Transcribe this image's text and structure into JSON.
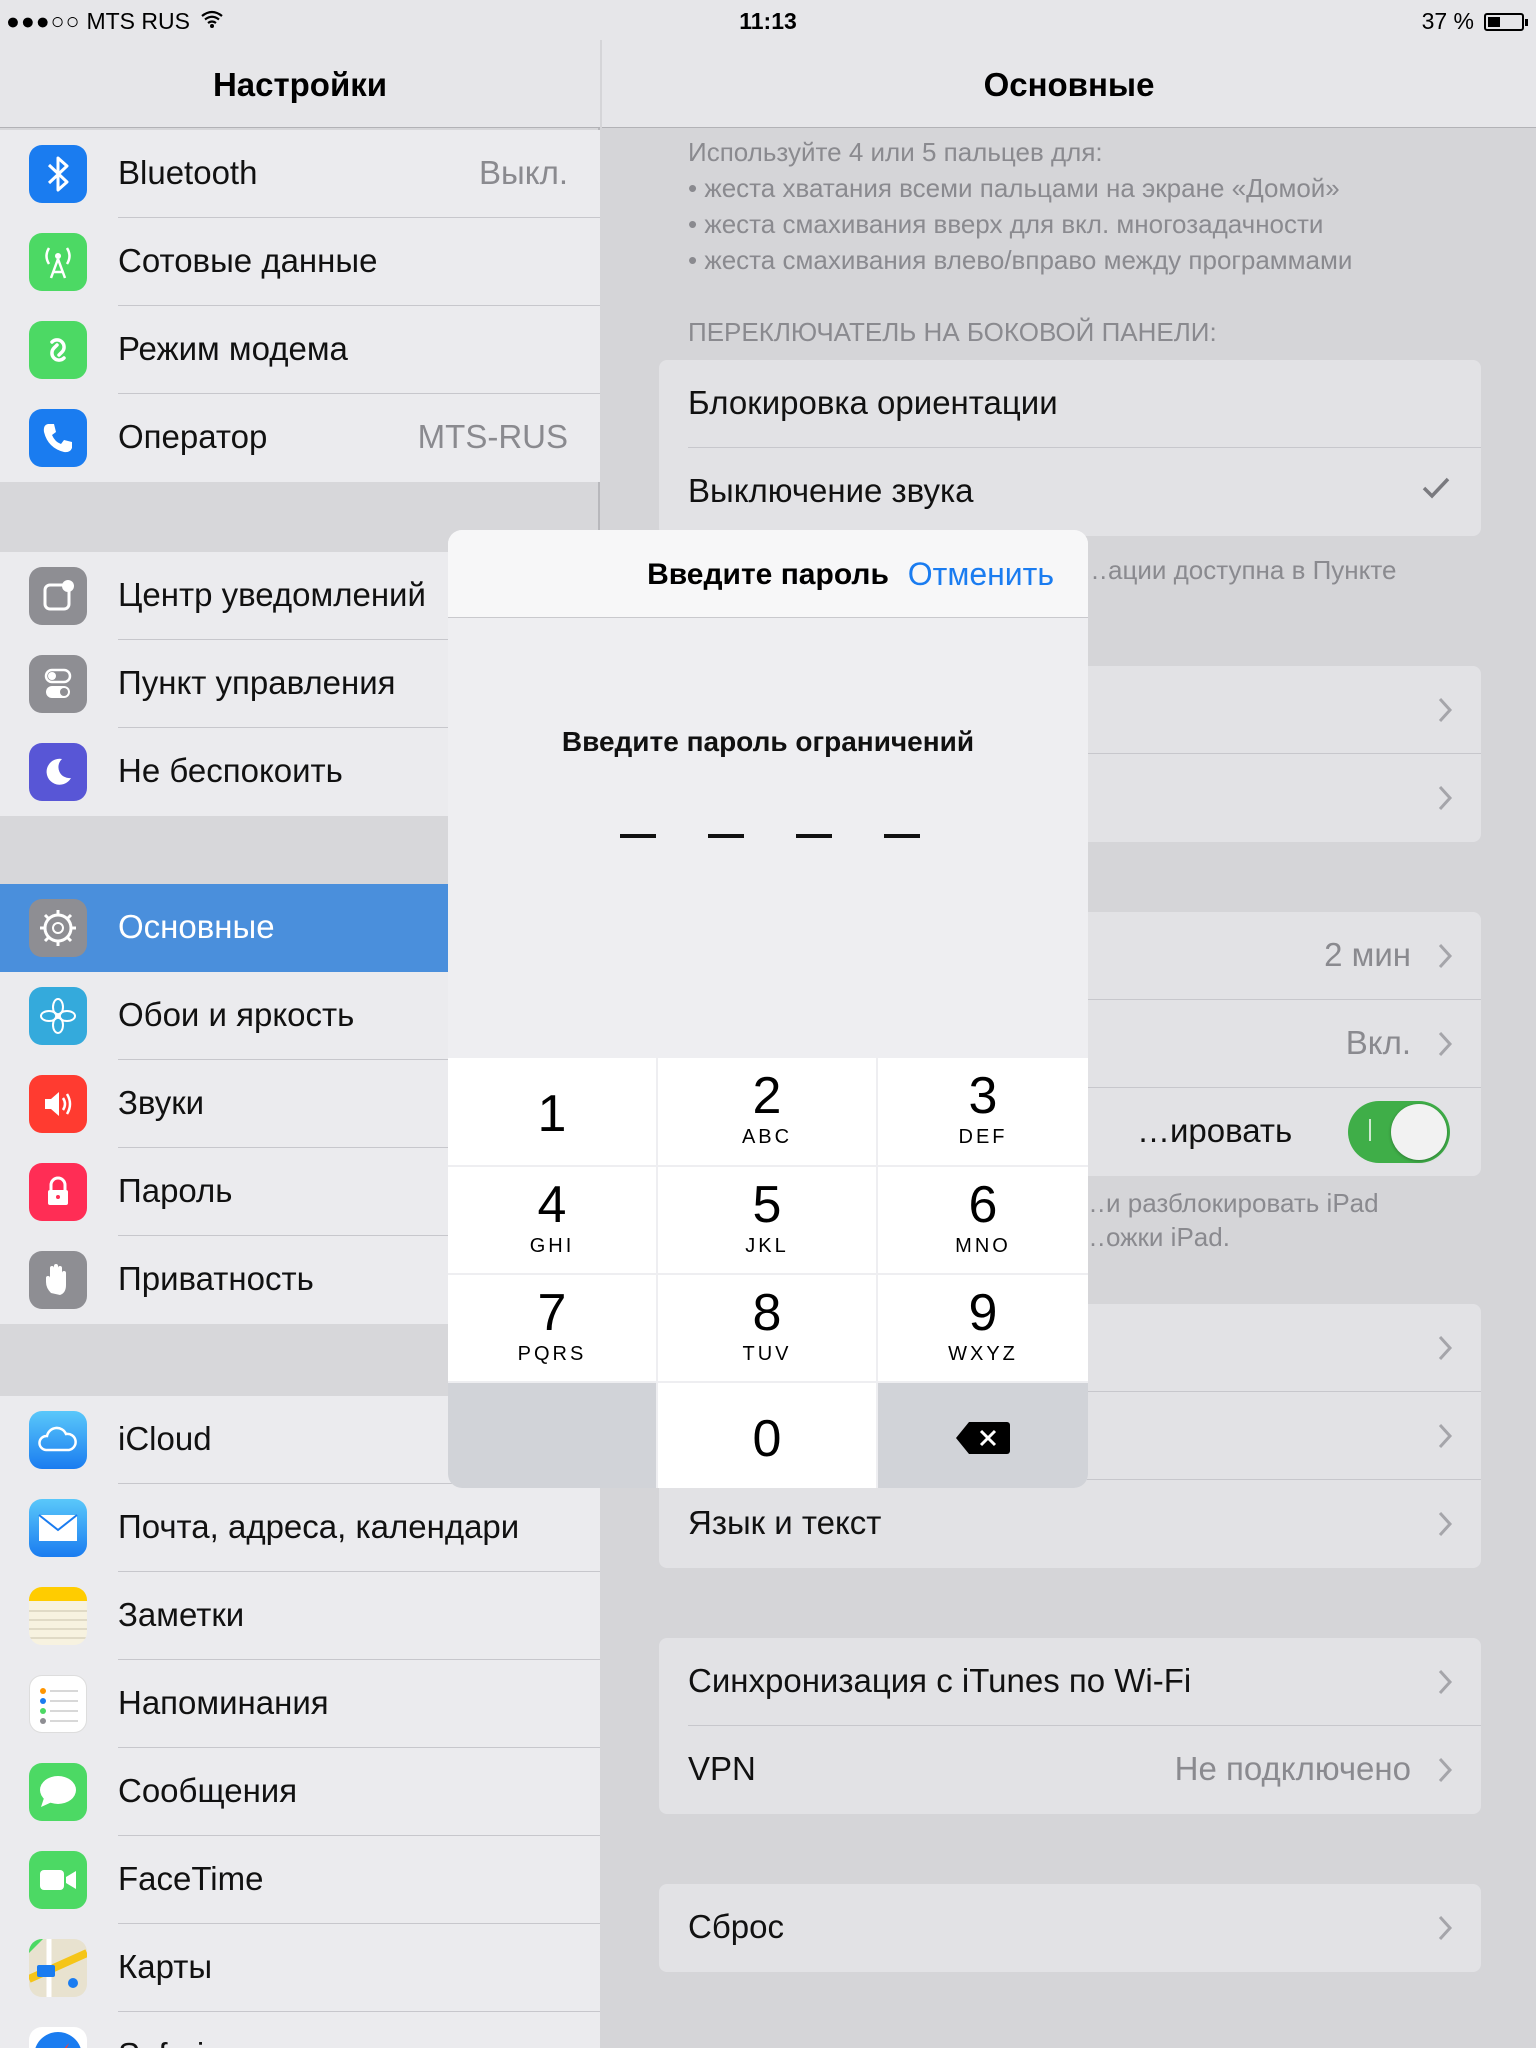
{
  "status_bar": {
    "carrier": "MTS RUS",
    "time": "11:13",
    "battery": "37 %",
    "battery_level": 0.37
  },
  "left_panel": {
    "title": "Настройки",
    "groups": [
      {
        "items": [
          {
            "label": "Bluetooth",
            "value": "Выкл.",
            "icon": "bluetooth-icon",
            "color": "#1a7cf0"
          },
          {
            "label": "Сотовые данные",
            "icon": "cellular-icon",
            "color": "#4cd964"
          },
          {
            "label": "Режим модема",
            "icon": "hotspot-icon",
            "color": "#4cd964"
          },
          {
            "label": "Оператор",
            "value": "MTS-RUS",
            "icon": "phone-icon",
            "color": "#1a7cf0"
          }
        ]
      },
      {
        "items": [
          {
            "label": "Центр уведомлений",
            "icon": "notifications-icon",
            "color": "#8e8e93"
          },
          {
            "label": "Пункт управления",
            "icon": "control-center-icon",
            "color": "#8e8e93"
          },
          {
            "label": "Не беспокоить",
            "icon": "moon-icon",
            "color": "#5856d6"
          }
        ]
      },
      {
        "items": [
          {
            "label": "Основные",
            "icon": "gear-icon",
            "color": "#8e8e93",
            "selected": true
          },
          {
            "label": "Обои и яркость",
            "icon": "wallpaper-icon",
            "color": "#34aadc"
          },
          {
            "label": "Звуки",
            "icon": "sound-icon",
            "color": "#ff3b30"
          },
          {
            "label": "Пароль",
            "icon": "lock-icon",
            "color": "#ff2d55"
          },
          {
            "label": "Приватность",
            "icon": "hand-icon",
            "color": "#8e8e93"
          }
        ]
      },
      {
        "items": [
          {
            "label": "iCloud",
            "icon": "cloud-icon",
            "color": "#5ac8fa"
          },
          {
            "label": "Почта, адреса, календари",
            "icon": "mail-icon",
            "color": "#1a7cf0"
          },
          {
            "label": "Заметки",
            "icon": "notes-icon",
            "color": "#ffcc00"
          },
          {
            "label": "Напоминания",
            "icon": "reminders-icon",
            "color": "#ffffff"
          },
          {
            "label": "Сообщения",
            "icon": "messages-icon",
            "color": "#4cd964"
          },
          {
            "label": "FaceTime",
            "icon": "facetime-icon",
            "color": "#4cd964"
          },
          {
            "label": "Карты",
            "icon": "maps-icon",
            "color": "#e8e2cf"
          },
          {
            "label": "Safari",
            "icon": "safari-icon",
            "color": "#1a7cf0"
          }
        ]
      }
    ]
  },
  "right_panel": {
    "title": "Основные",
    "multitask_info": [
      "Используйте 4 или 5 пальцев для:",
      "• жеста хватания всеми пальцами на экране «Домой»",
      "• жеста смахивания вверх для вкл. многозадачности",
      "• жеста смахивания влево/вправо между программами"
    ],
    "side_switch_header": "ПЕРЕКЛЮЧАТЕЛЬ НА БОКОВОЙ ПАНЕЛИ:",
    "side_switch_options": [
      {
        "label": "Блокировка ориентации",
        "checked": false
      },
      {
        "label": "Выключение звука",
        "checked": true
      }
    ],
    "side_switch_footer": "…ации доступна в Пункте",
    "autolock_value": "2 мин",
    "restrictions_value": "Вкл.",
    "cover_lock_label": "…ировать",
    "cover_lock_on": true,
    "cover_footer": [
      "…и разблокировать iPad",
      "…ожки iPad."
    ],
    "language_label": "Язык и текст",
    "itunes_sync_label": "Синхронизация с iTunes по Wi-Fi",
    "vpn_label": "VPN",
    "vpn_value": "Не подключено",
    "reset_label": "Сброс"
  },
  "modal": {
    "title": "Введите пароль",
    "cancel": "Отменить",
    "prompt": "Введите пароль ограничений",
    "digits_entered": 0,
    "keys": [
      {
        "digit": "1",
        "letters": ""
      },
      {
        "digit": "2",
        "letters": "ABC"
      },
      {
        "digit": "3",
        "letters": "DEF"
      },
      {
        "digit": "4",
        "letters": "GHI"
      },
      {
        "digit": "5",
        "letters": "JKL"
      },
      {
        "digit": "6",
        "letters": "MNO"
      },
      {
        "digit": "7",
        "letters": "PQRS"
      },
      {
        "digit": "8",
        "letters": "TUV"
      },
      {
        "digit": "9",
        "letters": "WXYZ"
      },
      {
        "digit": "0",
        "letters": ""
      }
    ]
  }
}
